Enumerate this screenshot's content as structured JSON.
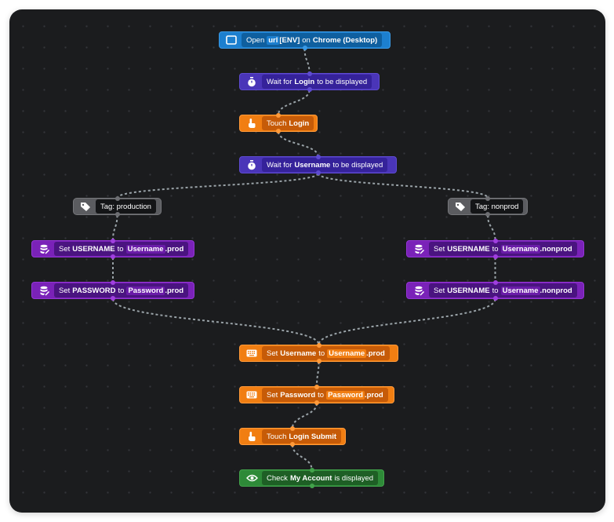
{
  "colors": {
    "canvas_bg": "#1b1c1e",
    "edge": "#9aa3a8",
    "open_blue": "#1c7fcf",
    "wait_violet": "#4a35b8",
    "touch_orange": "#f17e12",
    "variable_purple": "#7a22b8",
    "tag_gray": "#5b5c60",
    "check_green": "#2e8a38"
  },
  "nodes": {
    "open": {
      "verb": "Open",
      "chip": "url",
      "target": "[ENV]",
      "mid": "on",
      "browser": "Chrome (Desktop)",
      "icon": "browser-window-icon"
    },
    "wait_login": {
      "verb": "Wait for",
      "target": "Login",
      "suffix": "to be displayed",
      "icon": "stopwatch-icon"
    },
    "touch_login": {
      "verb": "Touch",
      "target": "Login",
      "icon": "tap-hand-icon"
    },
    "wait_username": {
      "verb": "Wait for",
      "target": "Username",
      "suffix": "to be displayed",
      "icon": "stopwatch-icon"
    },
    "tag_production": {
      "label": "Tag: production",
      "icon": "tag-icon"
    },
    "tag_nonprod": {
      "label": "Tag: nonprod",
      "icon": "tag-icon"
    },
    "prod_set_username": {
      "verb": "Set",
      "target": "USERNAME",
      "mid": "to",
      "chip": "Username",
      "suffix": ".prod",
      "icon": "database-edit-icon"
    },
    "prod_set_password": {
      "verb": "Set",
      "target": "PASSWORD",
      "mid": "to",
      "chip": "Password",
      "suffix": ".prod",
      "icon": "database-edit-icon"
    },
    "nonprod_set_username_1": {
      "verb": "Set",
      "target": "USERNAME",
      "mid": "to",
      "chip": "Username",
      "suffix": ".nonprod",
      "icon": "database-edit-icon"
    },
    "nonprod_set_username_2": {
      "verb": "Set",
      "target": "USERNAME",
      "mid": "to",
      "chip": "Username",
      "suffix": ".nonprod",
      "icon": "database-edit-icon"
    },
    "type_username": {
      "verb": "Set",
      "target": "Username",
      "mid": "to",
      "chip": "Username",
      "suffix": ".prod",
      "icon": "keyboard-icon"
    },
    "type_password": {
      "verb": "Set",
      "target": "Password",
      "mid": "to",
      "chip": "Password",
      "suffix": ".prod",
      "icon": "keyboard-icon"
    },
    "touch_submit": {
      "verb": "Touch",
      "target": "Login Submit",
      "icon": "tap-hand-icon"
    },
    "check_account": {
      "verb": "Check",
      "target": "My Account",
      "suffix": "is displayed",
      "icon": "eye-icon"
    }
  },
  "edges": [
    [
      "open",
      "wait_login"
    ],
    [
      "wait_login",
      "touch_login"
    ],
    [
      "touch_login",
      "wait_username"
    ],
    [
      "wait_username",
      "tag_production"
    ],
    [
      "wait_username",
      "tag_nonprod"
    ],
    [
      "tag_production",
      "prod_set_username"
    ],
    [
      "prod_set_username",
      "prod_set_password"
    ],
    [
      "tag_nonprod",
      "nonprod_set_username_1"
    ],
    [
      "nonprod_set_username_1",
      "nonprod_set_username_2"
    ],
    [
      "prod_set_password",
      "type_username"
    ],
    [
      "nonprod_set_username_2",
      "type_username"
    ],
    [
      "type_username",
      "type_password"
    ],
    [
      "type_password",
      "touch_submit"
    ],
    [
      "touch_submit",
      "check_account"
    ]
  ]
}
